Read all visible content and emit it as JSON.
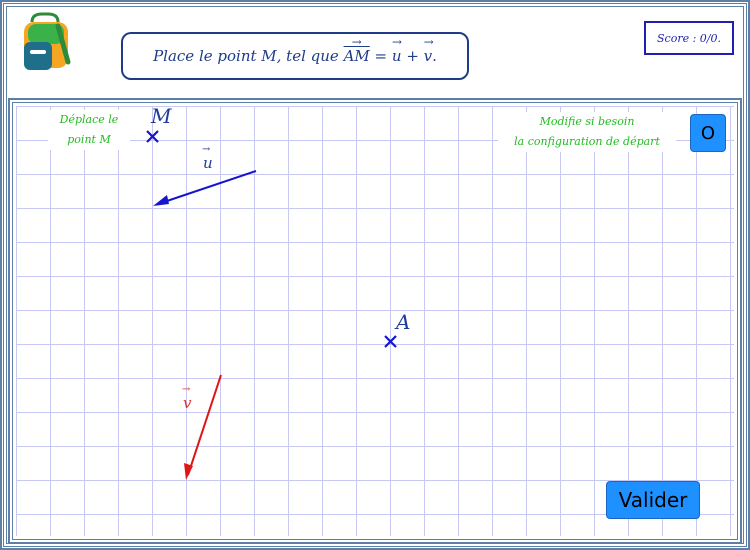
{
  "header": {
    "instruction": {
      "prefix": "Place le point M, tel que ",
      "vector_AM": "AM",
      "equals": " = ",
      "vector_u": "u",
      "plus": " + ",
      "vector_v": "v",
      "suffix": "."
    },
    "score": "Score : 0/0."
  },
  "hints": {
    "move_point_line1": "Déplace le",
    "move_point_line2": "point M",
    "config_line1": "Modifie si besoin",
    "config_line2": "la configuration de départ"
  },
  "buttons": {
    "reset": "O",
    "validate": "Valider"
  },
  "points": {
    "M": "M",
    "A": "A"
  },
  "vectors": {
    "u": "u",
    "v": "v"
  },
  "colors": {
    "frame": "#5b7fa6",
    "grid": "#c8c8f5",
    "point": "#1f3c9a",
    "vector_u": "#1515d0",
    "vector_v": "#e01515",
    "hint": "#22bb22",
    "button": "#1e90ff"
  }
}
